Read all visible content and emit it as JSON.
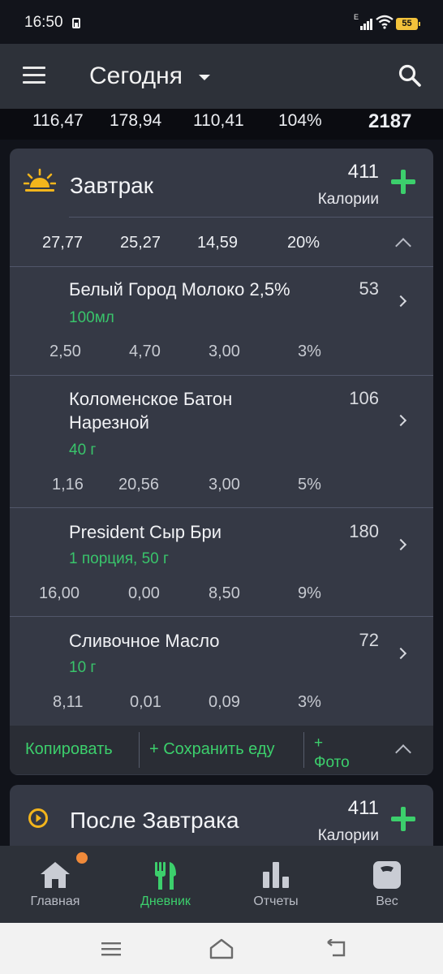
{
  "status_bar": {
    "time": "16:50",
    "signal_label": "E",
    "battery": "55"
  },
  "app_bar": {
    "title": "Сегодня"
  },
  "totals": {
    "fat": "116,47",
    "carbs": "178,94",
    "protein": "110,41",
    "rdi": "104%",
    "calories": "2187"
  },
  "meals": [
    {
      "title": "Завтрак",
      "calories": "411",
      "calories_label": "Калории",
      "icon": "sunrise-icon",
      "macros": {
        "fat": "27,77",
        "carbs": "25,27",
        "protein": "14,59",
        "rdi": "20%"
      },
      "items": [
        {
          "name": "Белый Город Молоко 2,5%",
          "portion": "100мл",
          "calories": "53",
          "fat": "2,50",
          "carbs": "4,70",
          "protein": "3,00",
          "rdi": "3%"
        },
        {
          "name": "Коломенское Батон Нарезной",
          "portion": "40 г",
          "calories": "106",
          "fat": "1,16",
          "carbs": "20,56",
          "protein": "3,00",
          "rdi": "5%"
        },
        {
          "name": "President Сыр Бри",
          "portion": "1 порция, 50 г",
          "calories": "180",
          "fat": "16,00",
          "carbs": "0,00",
          "protein": "8,50",
          "rdi": "9%"
        },
        {
          "name": "Сливочное Масло",
          "portion": "10 г",
          "calories": "72",
          "fat": "8,11",
          "carbs": "0,01",
          "protein": "0,09",
          "rdi": "3%"
        }
      ],
      "footer": {
        "copy": "Копировать",
        "save": "+ Сохранить еду",
        "photo_plus": "+",
        "photo": "Фото"
      }
    },
    {
      "title": "После Завтрака",
      "calories": "411",
      "calories_label": "Калории",
      "icon": "play-circle-icon"
    }
  ],
  "bottom_nav": [
    {
      "label": "Главная",
      "icon": "home-icon"
    },
    {
      "label": "Дневник",
      "icon": "fork-knife-icon",
      "active": true
    },
    {
      "label": "Отчеты",
      "icon": "bar-chart-icon"
    },
    {
      "label": "Вес",
      "icon": "scale-icon"
    }
  ],
  "colors": {
    "accent_green": "#3ccf6c",
    "card_bg": "#353945",
    "app_bar_bg": "#2d3139",
    "sun_yellow": "#f3b51c",
    "notif_orange": "#f08a3a"
  }
}
